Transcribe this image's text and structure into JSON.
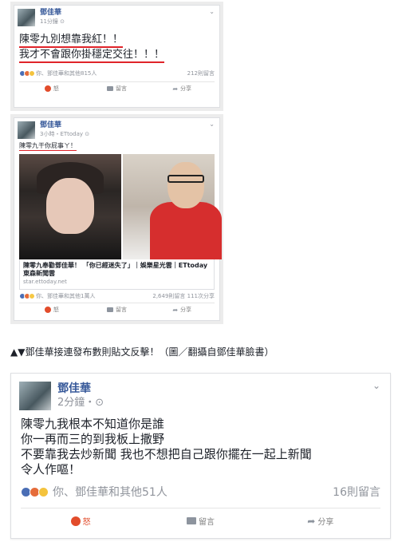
{
  "post1": {
    "author": "鄧佳華",
    "time": "11分鐘",
    "line1": "陳零九別想靠我紅！！",
    "line2": "我才不會跟你掛穩定交往！！！",
    "reactions_text": "你、鄧佳華和其他815人",
    "comments": "212則留言",
    "actions": {
      "react": "怒",
      "comment": "留言",
      "share": "分享"
    }
  },
  "post2": {
    "author": "鄧佳華",
    "time": "3小時・ETtoday",
    "text": "陳零九干你屁事ㄚ！",
    "link_title": "陳零九奉勸鄧佳華！ 「你已經迷失了」｜娛樂星光雲｜ETtoday東森新聞雲",
    "link_domain": "star.ettoday.net",
    "reactions_text": "你、鄧佳華和其他1萬人",
    "comments": "2,649則留言 111次分享",
    "actions": {
      "react": "怒",
      "comment": "留言",
      "share": "分享"
    }
  },
  "caption": "▲▼鄧佳華接連發布數則貼文反擊！（圖／翻攝自鄧佳華臉書）",
  "post3": {
    "author": "鄧佳華",
    "time": "2分鐘・",
    "lines": [
      "陳零九我根本不知道你是誰",
      "你一再而三的到我板上撒野",
      "不要靠我去炒新聞 我也不想把自己跟你擺在一起上新聞",
      "令人作嘔！"
    ],
    "reactions_text": "你、鄧佳華和其他51人",
    "comments": "16則留言",
    "actions": {
      "react": "怒",
      "comment": "留言",
      "share": "分享"
    }
  },
  "colors": {
    "name_link": "#365899",
    "underline": "#e0242a",
    "meta": "#90949c"
  }
}
